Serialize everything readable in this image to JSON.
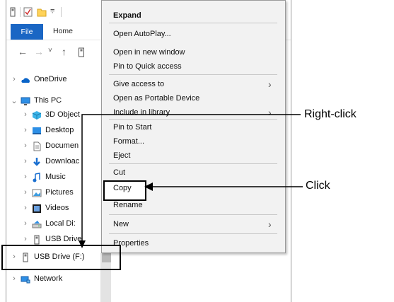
{
  "explorer": {
    "ribbon": {
      "file_tab": "File",
      "home_tab": "Home"
    },
    "tree": [
      {
        "label": "OneDrive",
        "icon": "cloud-icon",
        "chevron": "›"
      },
      {
        "label": "This PC",
        "icon": "monitor-icon",
        "chevron": "⌄"
      },
      {
        "label": "3D Object",
        "icon": "cube-icon",
        "chevron": "›"
      },
      {
        "label": "Desktop",
        "icon": "desktop-folder-icon",
        "chevron": "›"
      },
      {
        "label": "Documen",
        "icon": "document-icon",
        "chevron": "›"
      },
      {
        "label": "Downloac",
        "icon": "download-icon",
        "chevron": "›"
      },
      {
        "label": "Music",
        "icon": "music-icon",
        "chevron": "›"
      },
      {
        "label": "Pictures",
        "icon": "pictures-icon",
        "chevron": "›"
      },
      {
        "label": "Videos",
        "icon": "video-icon",
        "chevron": "›"
      },
      {
        "label": "Local Di:",
        "icon": "hard-drive-icon",
        "chevron": "›"
      },
      {
        "label": "USB Drive",
        "icon": "usb-drive-icon",
        "chevron": "›"
      },
      {
        "label": "USB Drive (F:)",
        "icon": "usb-drive-icon",
        "chevron": "›"
      },
      {
        "label": "Network",
        "icon": "network-icon",
        "chevron": "›"
      }
    ]
  },
  "context_menu": {
    "items": [
      {
        "label": "Expand",
        "bold": true
      },
      {
        "label": "Open AutoPlay..."
      },
      {
        "label": "Open in new window"
      },
      {
        "label": "Pin to Quick access"
      },
      {
        "label": "Give access to",
        "submenu": true
      },
      {
        "label": "Open as Portable Device"
      },
      {
        "label": "Include in library",
        "submenu": true
      },
      {
        "label": "Pin to Start"
      },
      {
        "label": "Format..."
      },
      {
        "label": "Eject"
      },
      {
        "label": "Cut"
      },
      {
        "label": "Copy",
        "highlighted": true
      },
      {
        "label": "Rename"
      },
      {
        "label": "New",
        "submenu": true
      },
      {
        "label": "Properties"
      }
    ],
    "submenu_arrow": "›"
  },
  "callouts": {
    "right_click": "Right-click",
    "click": "Click"
  },
  "colors": {
    "file_tab": "#1a66c4",
    "menu_bg": "#f2f2f2"
  }
}
